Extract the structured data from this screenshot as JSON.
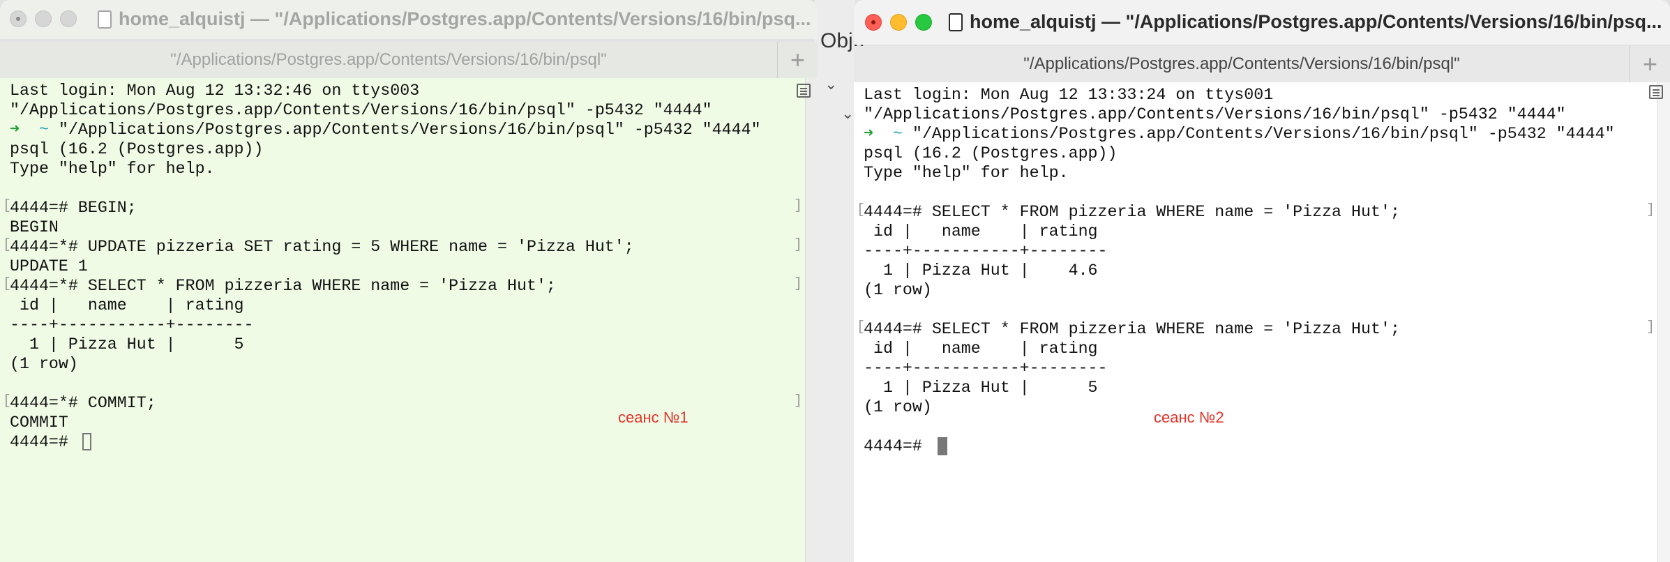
{
  "background": {
    "obscured_text": "Obje"
  },
  "session1": {
    "title": "home_alquistj — \"/Applications/Postgres.app/Contents/Versions/16/bin/psq...",
    "tab_label": "\"/Applications/Postgres.app/Contents/Versions/16/bin/psql\"",
    "add_tab": "+",
    "lines": [
      "Last login: Mon Aug 12 13:32:46 on ttys003",
      "\"/Applications/Postgres.app/Contents/Versions/16/bin/psql\" -p5432 \"4444\"",
      "\"/Applications/Postgres.app/Contents/Versions/16/bin/psql\" -p5432 \"4444\"",
      "psql (16.2 (Postgres.app))",
      "Type \"help\" for help.",
      "",
      "4444=# BEGIN;",
      "BEGIN",
      "4444=*# UPDATE pizzeria SET rating = 5 WHERE name = 'Pizza Hut';",
      "UPDATE 1",
      "4444=*# SELECT * FROM pizzeria WHERE name = 'Pizza Hut';",
      " id |   name    | rating",
      "----+-----------+--------",
      "  1 | Pizza Hut |      5",
      "(1 row)",
      "",
      "4444=*# COMMIT;",
      "COMMIT",
      "4444=# "
    ],
    "prompt_arrow": "➜",
    "prompt_tilde": "~",
    "label": "сеанс №1"
  },
  "session2": {
    "title": "home_alquistj — \"/Applications/Postgres.app/Contents/Versions/16/bin/psq...",
    "tab_label": "\"/Applications/Postgres.app/Contents/Versions/16/bin/psql\"",
    "add_tab": "+",
    "lines": [
      "Last login: Mon Aug 12 13:33:24 on ttys001",
      "\"/Applications/Postgres.app/Contents/Versions/16/bin/psql\" -p5432 \"4444\"",
      "\"/Applications/Postgres.app/Contents/Versions/16/bin/psql\" -p5432 \"4444\"",
      "psql (16.2 (Postgres.app))",
      "Type \"help\" for help.",
      "",
      "4444=# SELECT * FROM pizzeria WHERE name = 'Pizza Hut';",
      " id |   name    | rating",
      "----+-----------+--------",
      "  1 | Pizza Hut |    4.6",
      "(1 row)",
      "",
      "4444=# SELECT * FROM pizzeria WHERE name = 'Pizza Hut';",
      " id |   name    | rating",
      "----+-----------+--------",
      "  1 | Pizza Hut |      5",
      "(1 row)",
      "",
      "4444=# "
    ],
    "prompt_arrow": "➜",
    "prompt_tilde": "~",
    "label": "сеанс №2"
  },
  "colors": {
    "session1_bg": "#f0fbe6",
    "session2_bg": "#ffffff",
    "label": "#e0332a",
    "prompt_arrow": "#23a035",
    "prompt_tilde": "#1ea0b8"
  }
}
